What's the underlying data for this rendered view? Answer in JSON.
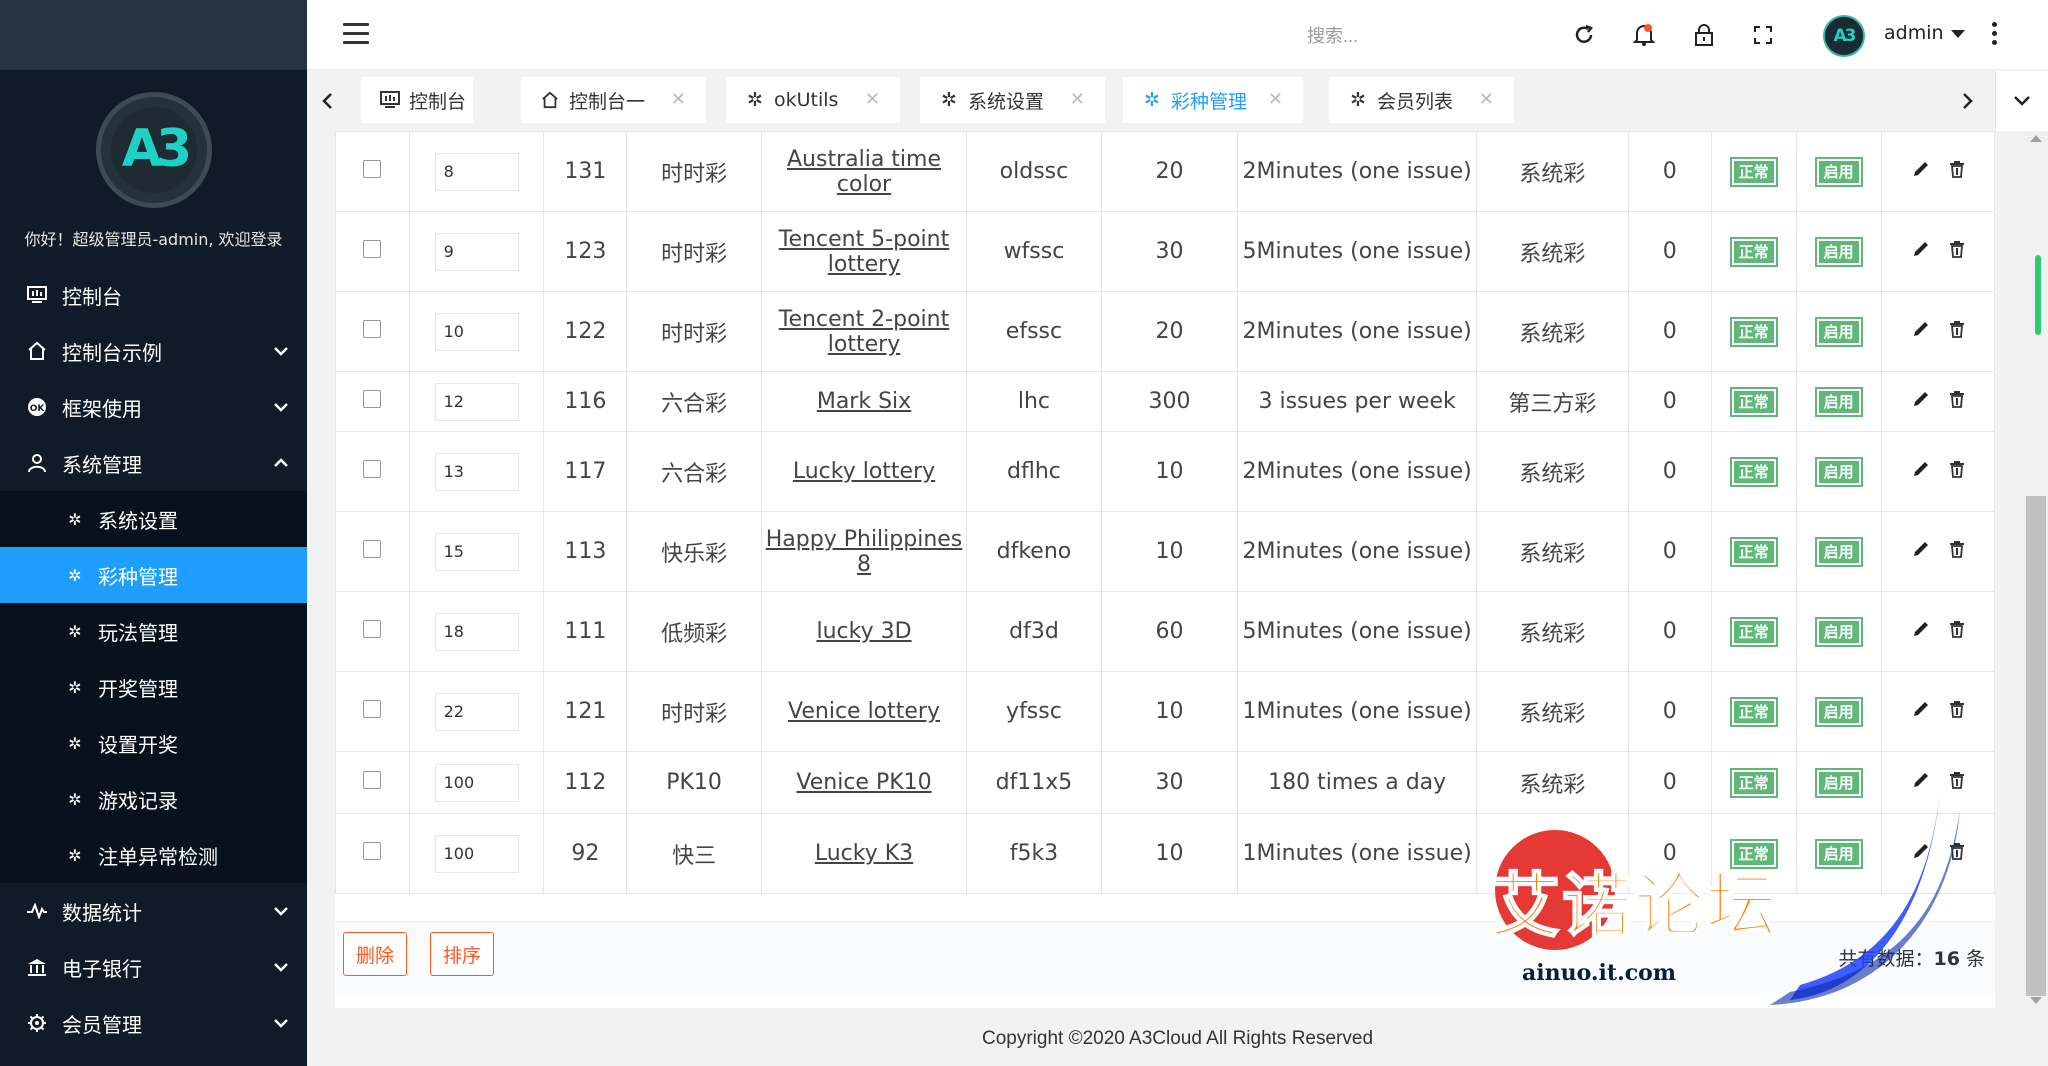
{
  "sidebar": {
    "logo_text": "A3",
    "welcome": "你好！超级管理员-admin, 欢迎登录",
    "menu": [
      {
        "label": "控制台",
        "icon": "monitor-icon"
      },
      {
        "label": "控制台示例",
        "icon": "home-icon"
      },
      {
        "label": "框架使用",
        "icon": "ok-icon"
      },
      {
        "label": "系统管理",
        "icon": "user-icon"
      },
      {
        "label": "数据统计",
        "icon": "pulse-icon"
      },
      {
        "label": "电子银行",
        "icon": "bank-icon"
      },
      {
        "label": "会员管理",
        "icon": "gear-icon"
      }
    ],
    "submenu": [
      {
        "label": "系统设置"
      },
      {
        "label": "彩种管理"
      },
      {
        "label": "玩法管理"
      },
      {
        "label": "开奖管理"
      },
      {
        "label": "设置开奖"
      },
      {
        "label": "游戏记录"
      },
      {
        "label": "注单异常检测"
      }
    ]
  },
  "header": {
    "search_placeholder": "搜索...",
    "username": "admin",
    "avatar_text": "A3"
  },
  "tabs": [
    {
      "label": "控制台",
      "closable": false
    },
    {
      "label": "控制台一",
      "closable": true
    },
    {
      "label": "okUtils",
      "closable": true
    },
    {
      "label": "系统设置",
      "closable": true
    },
    {
      "label": "彩种管理",
      "closable": true,
      "active": true
    },
    {
      "label": "会员列表",
      "closable": true
    }
  ],
  "table": {
    "rows": [
      {
        "sort": "8",
        "id": "131",
        "type": "时时彩",
        "name": "Australia time color",
        "code": "oldssc",
        "val": "20",
        "freq": "2Minutes (one issue)",
        "src": "系统彩",
        "zero": "0",
        "status": "正常",
        "enabled": "启用"
      },
      {
        "sort": "9",
        "id": "123",
        "type": "时时彩",
        "name": "Tencent 5-point lottery",
        "code": "wfssc",
        "val": "30",
        "freq": "5Minutes (one issue)",
        "src": "系统彩",
        "zero": "0",
        "status": "正常",
        "enabled": "启用"
      },
      {
        "sort": "10",
        "id": "122",
        "type": "时时彩",
        "name": "Tencent 2-point lottery",
        "code": "efssc",
        "val": "20",
        "freq": "2Minutes (one issue)",
        "src": "系统彩",
        "zero": "0",
        "status": "正常",
        "enabled": "启用"
      },
      {
        "sort": "12",
        "id": "116",
        "type": "六合彩",
        "name": "Mark Six",
        "code": "lhc",
        "val": "300",
        "freq": "3 issues per week",
        "src": "第三方彩",
        "zero": "0",
        "status": "正常",
        "enabled": "启用"
      },
      {
        "sort": "13",
        "id": "117",
        "type": "六合彩",
        "name": "Lucky lottery",
        "code": "dflhc",
        "val": "10",
        "freq": "2Minutes (one issue)",
        "src": "系统彩",
        "zero": "0",
        "status": "正常",
        "enabled": "启用"
      },
      {
        "sort": "15",
        "id": "113",
        "type": "快乐彩",
        "name": "Happy Philippines 8",
        "code": "dfkeno",
        "val": "10",
        "freq": "2Minutes (one issue)",
        "src": "系统彩",
        "zero": "0",
        "status": "正常",
        "enabled": "启用"
      },
      {
        "sort": "18",
        "id": "111",
        "type": "低频彩",
        "name": "lucky 3D",
        "code": "df3d",
        "val": "60",
        "freq": "5Minutes (one issue)",
        "src": "系统彩",
        "zero": "0",
        "status": "正常",
        "enabled": "启用"
      },
      {
        "sort": "22",
        "id": "121",
        "type": "时时彩",
        "name": "Venice lottery",
        "code": "yfssc",
        "val": "10",
        "freq": "1Minutes (one issue)",
        "src": "系统彩",
        "zero": "0",
        "status": "正常",
        "enabled": "启用"
      },
      {
        "sort": "100",
        "id": "112",
        "type": "PK10",
        "name": "Venice PK10",
        "code": "df11x5",
        "val": "30",
        "freq": "180 times a day",
        "src": "系统彩",
        "zero": "0",
        "status": "正常",
        "enabled": "启用"
      },
      {
        "sort": "100",
        "id": "92",
        "type": "快三",
        "name": "Lucky K3",
        "code": "f5k3",
        "val": "10",
        "freq": "1Minutes (one issue)",
        "src": "系统彩",
        "zero": "0",
        "status": "正常",
        "enabled": "启用"
      }
    ]
  },
  "footer_bar": {
    "delete_label": "删除",
    "sort_label": "排序",
    "total_prefix": "共有数据：",
    "total_count": "16",
    "total_suffix": " 条"
  },
  "copyright": "Copyright ©2020 A3Cloud All Rights Reserved",
  "watermark": {
    "title": "艾诺论坛",
    "url": "ainuo.it.com"
  }
}
